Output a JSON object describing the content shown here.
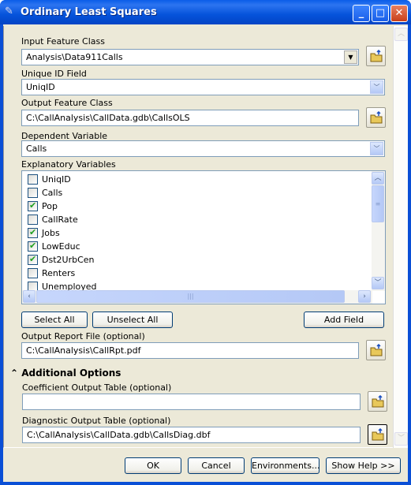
{
  "window": {
    "title": "Ordinary Least Squares",
    "icon": "tool-script-icon"
  },
  "input_feature_class": {
    "label": "Input Feature Class",
    "value": "Analysis\\Data911Calls"
  },
  "unique_id_field": {
    "label": "Unique ID Field",
    "value": "UniqID"
  },
  "output_feature_class": {
    "label": "Output Feature Class",
    "value": "C:\\CallAnalysis\\CallData.gdb\\CallsOLS"
  },
  "dependent_variable": {
    "label": "Dependent Variable",
    "value": "Calls"
  },
  "explanatory_variables": {
    "label": "Explanatory Variables",
    "items": [
      {
        "label": "UniqID",
        "checked": false
      },
      {
        "label": "Calls",
        "checked": false
      },
      {
        "label": "Pop",
        "checked": true
      },
      {
        "label": "CallRate",
        "checked": false
      },
      {
        "label": "Jobs",
        "checked": true
      },
      {
        "label": "LowEduc",
        "checked": true
      },
      {
        "label": "Dst2UrbCen",
        "checked": true
      },
      {
        "label": "Renters",
        "checked": false
      },
      {
        "label": "Unemployed",
        "checked": false
      }
    ],
    "select_all": "Select All",
    "unselect_all": "Unselect All",
    "add_field": "Add Field"
  },
  "output_report_file": {
    "label": "Output Report File (optional)",
    "value": "C:\\CallAnalysis\\CallRpt.pdf"
  },
  "additional_options": {
    "label": "Additional Options",
    "coefficient_table": {
      "label": "Coefficient Output Table (optional)",
      "value": ""
    },
    "diagnostic_table": {
      "label": "Diagnostic Output Table (optional)",
      "value": "C:\\CallAnalysis\\CallData.gdb\\CallsDiag.dbf"
    }
  },
  "footer": {
    "ok": "OK",
    "cancel": "Cancel",
    "environments": "Environments...",
    "show_help": "Show Help >>"
  }
}
